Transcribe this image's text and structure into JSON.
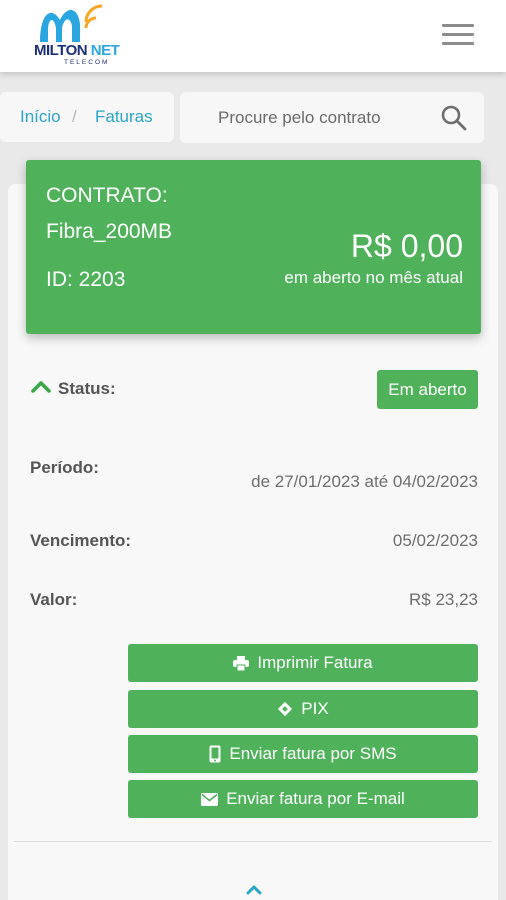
{
  "header": {
    "logo_text_a": "MILTON",
    "logo_text_b": "NET",
    "logo_sub": "TELECOM",
    "menu_icon": "hamburger-icon"
  },
  "breadcrumb": {
    "home": "Início",
    "separator": "/",
    "current": "Faturas"
  },
  "search": {
    "placeholder": "Procure pelo contrato",
    "icon": "search-icon"
  },
  "contract": {
    "title": "CONTRATO:",
    "plan": "Fibra_200MB",
    "id": "ID: 2203",
    "amount": "R$ 0,00",
    "amount_caption": "em aberto no mês atual",
    "color": "#4fb15a"
  },
  "invoice": {
    "status_label": "Status:",
    "status_value": "Em aberto",
    "period_label": "Período:",
    "period_value": "de 27/01/2023 até 04/02/2023",
    "due_label": "Vencimento:",
    "due_value": "05/02/2023",
    "amount_label": "Valor:",
    "amount_value": "R$ 23,23"
  },
  "actions": [
    {
      "label": "Imprimir Fatura",
      "icon": "printer-icon"
    },
    {
      "label": "PIX",
      "icon": "pix-icon"
    },
    {
      "label": "Enviar fatura por SMS",
      "icon": "mobile-icon"
    },
    {
      "label": "Enviar fatura por E-mail",
      "icon": "envelope-icon"
    }
  ]
}
